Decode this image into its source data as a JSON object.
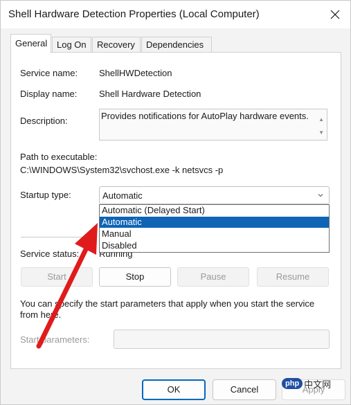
{
  "window": {
    "title": "Shell Hardware Detection Properties (Local Computer)",
    "close_icon": "close-icon"
  },
  "tabs": [
    {
      "label": "General",
      "active": true
    },
    {
      "label": "Log On",
      "active": false
    },
    {
      "label": "Recovery",
      "active": false
    },
    {
      "label": "Dependencies",
      "active": false
    }
  ],
  "general": {
    "service_name_label": "Service name:",
    "service_name_value": "ShellHWDetection",
    "display_name_label": "Display name:",
    "display_name_value": "Shell Hardware Detection",
    "description_label": "Description:",
    "description_value": "Provides notifications for AutoPlay hardware events.",
    "path_label": "Path to executable:",
    "path_value": "C:\\WINDOWS\\System32\\svchost.exe -k netsvcs -p",
    "startup_type_label": "Startup type:",
    "startup_type_value": "Automatic",
    "startup_options": [
      "Automatic (Delayed Start)",
      "Automatic",
      "Manual",
      "Disabled"
    ],
    "startup_selected_option": "Automatic",
    "service_status_label": "Service status:",
    "service_status_value": "Running",
    "buttons": {
      "start": "Start",
      "stop": "Stop",
      "pause": "Pause",
      "resume": "Resume"
    },
    "hint_text_line1": "You can specify the start parameters that apply when you start the service",
    "hint_text_line2": "from here.",
    "start_params_label": "Start parameters:",
    "start_params_value": ""
  },
  "footer": {
    "ok": "OK",
    "cancel": "Cancel",
    "apply": "Apply"
  },
  "watermark": {
    "badge": "php",
    "text": "中文网"
  },
  "colors": {
    "selection": "#0f64b5",
    "arrow": "#e01b1b",
    "primary_border": "#0067c0"
  }
}
